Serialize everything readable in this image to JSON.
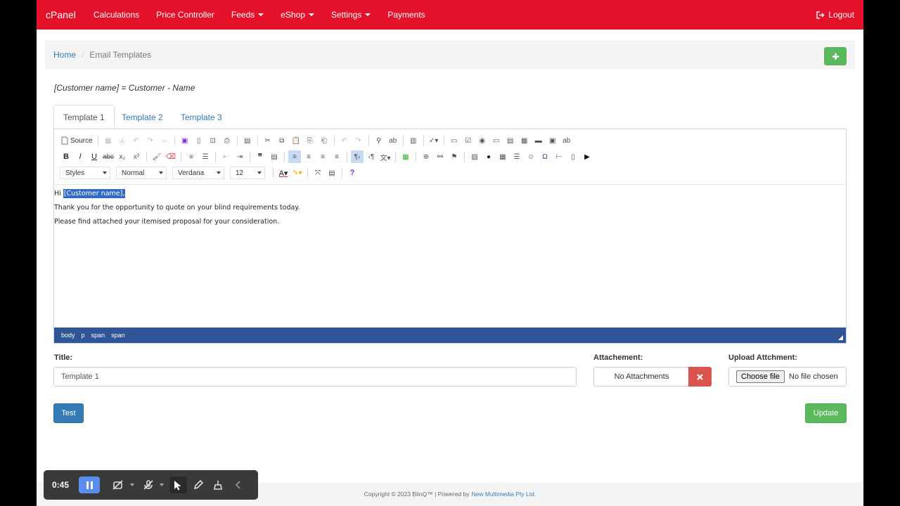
{
  "navbar": {
    "brand": "cPanel",
    "items": [
      {
        "label": "Calculations",
        "dropdown": false
      },
      {
        "label": "Price Controller",
        "dropdown": false
      },
      {
        "label": "Feeds",
        "dropdown": true
      },
      {
        "label": "eShop",
        "dropdown": true
      },
      {
        "label": "Settings",
        "dropdown": true
      },
      {
        "label": "Payments",
        "dropdown": false
      }
    ],
    "logout": "Logout",
    "color": "#e4112a"
  },
  "breadcrumb": {
    "home": "Home",
    "current": "Email Templates"
  },
  "hint": "[Customer name] = Customer - Name",
  "tabs": [
    "Template 1",
    "Template 2",
    "Template 3"
  ],
  "editor": {
    "toolbar": {
      "source_label": "Source",
      "styles": "Styles",
      "format": "Normal",
      "font": "Verdana",
      "size": "12"
    },
    "content": {
      "greeting": "Hi",
      "placeholder": "[Customer name],",
      "line2": "Thank you for the opportunity to quote on your blind requirements today.",
      "line3": "Please find attached your itemised proposal for your consideration."
    },
    "path": [
      "body",
      "p",
      "span",
      "span"
    ]
  },
  "form": {
    "title_label": "Title:",
    "title_value": "Template 1",
    "attachment_label": "Attachement:",
    "attachment_value": "No Attachments",
    "upload_label": "Upload Attchment:",
    "choose_file": "Choose file",
    "no_file": "No file chosen"
  },
  "buttons": {
    "test": "Test",
    "update": "Update"
  },
  "footer": {
    "text": "Copyright © 2023 BlinQ™ | Powered by",
    "link": "New Multimedia Pty Ltd."
  },
  "recorder": {
    "time": "0:45"
  }
}
